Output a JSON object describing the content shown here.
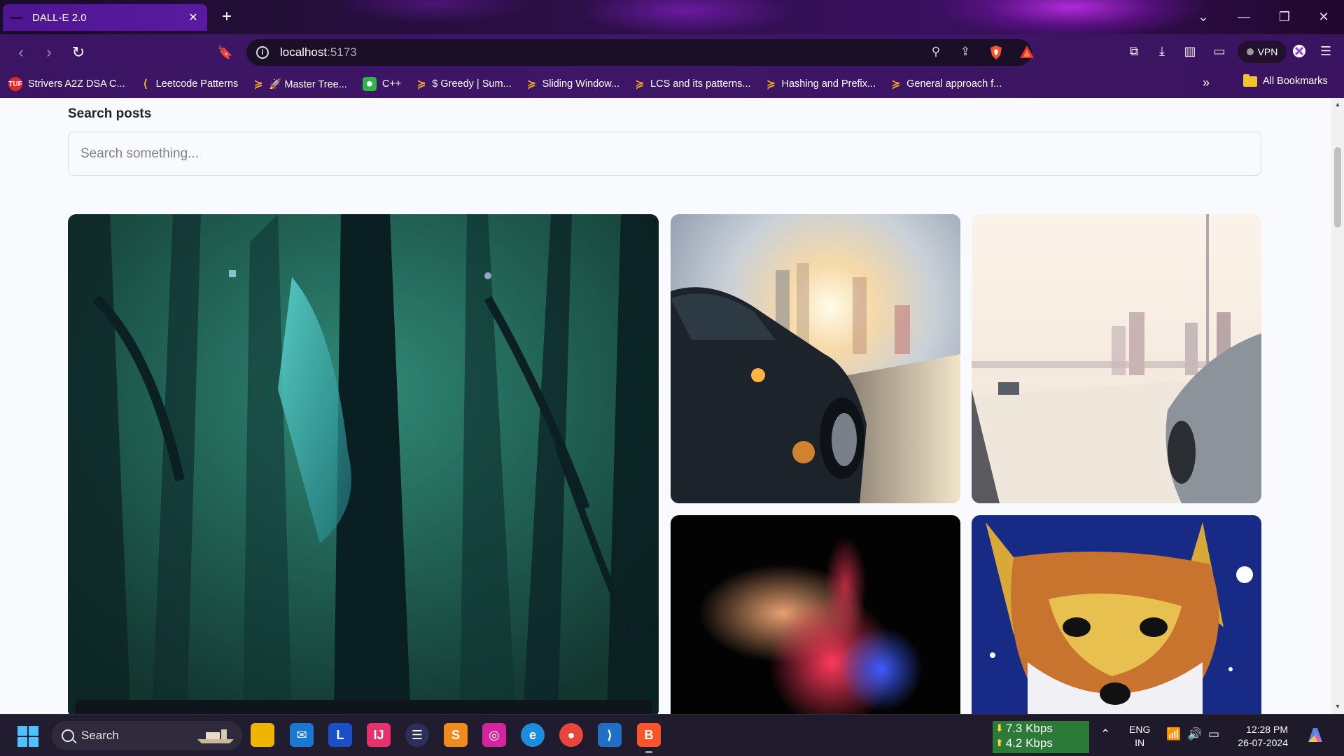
{
  "browser": {
    "tab_title": "DALL-E 2.0",
    "tab_close": "✕",
    "new_tab": "+",
    "url_host": "localhost",
    "url_port": ":5173",
    "vpn_label": "VPN"
  },
  "bookmarks": {
    "items": [
      {
        "label": "Strivers A2Z DSA C...",
        "icon": "tuf-icon",
        "color": "#e02a2a"
      },
      {
        "label": "Leetcode Patterns",
        "icon": "leetcode-icon",
        "color": "#f5a623"
      },
      {
        "label": "🚀 Master Tree...",
        "icon": "leetcode-icon",
        "color": "#f5a623"
      },
      {
        "label": "C++",
        "icon": "shield-icon",
        "color": "#2fb34a"
      },
      {
        "label": "$ Greedy | Sum...",
        "icon": "leetcode-icon",
        "color": "#f5a623"
      },
      {
        "label": "Sliding Window...",
        "icon": "leetcode-icon",
        "color": "#f5a623"
      },
      {
        "label": "LCS and its patterns...",
        "icon": "leetcode-icon",
        "color": "#f5a623"
      },
      {
        "label": "Hashing and Prefix...",
        "icon": "leetcode-icon",
        "color": "#f5a623"
      },
      {
        "label": "General approach f...",
        "icon": "leetcode-icon",
        "color": "#f5a623"
      }
    ],
    "more": "»",
    "all_bookmarks": "All Bookmarks"
  },
  "page": {
    "search_label": "Search posts",
    "search_placeholder": "Search something...",
    "search_value": ""
  },
  "taskbar": {
    "search_label": "Search",
    "net_down": "7.3 Kbps",
    "net_up": "4.2 Kbps",
    "lang_line1": "ENG",
    "lang_line2": "IN",
    "time": "12:28 PM",
    "date": "26-07-2024"
  },
  "colors": {
    "accent_purple": "#3b1563",
    "page_bg": "#f9fafe",
    "netspeed_bg": "#2c7a38",
    "start_blue": "#4cc2ff"
  }
}
